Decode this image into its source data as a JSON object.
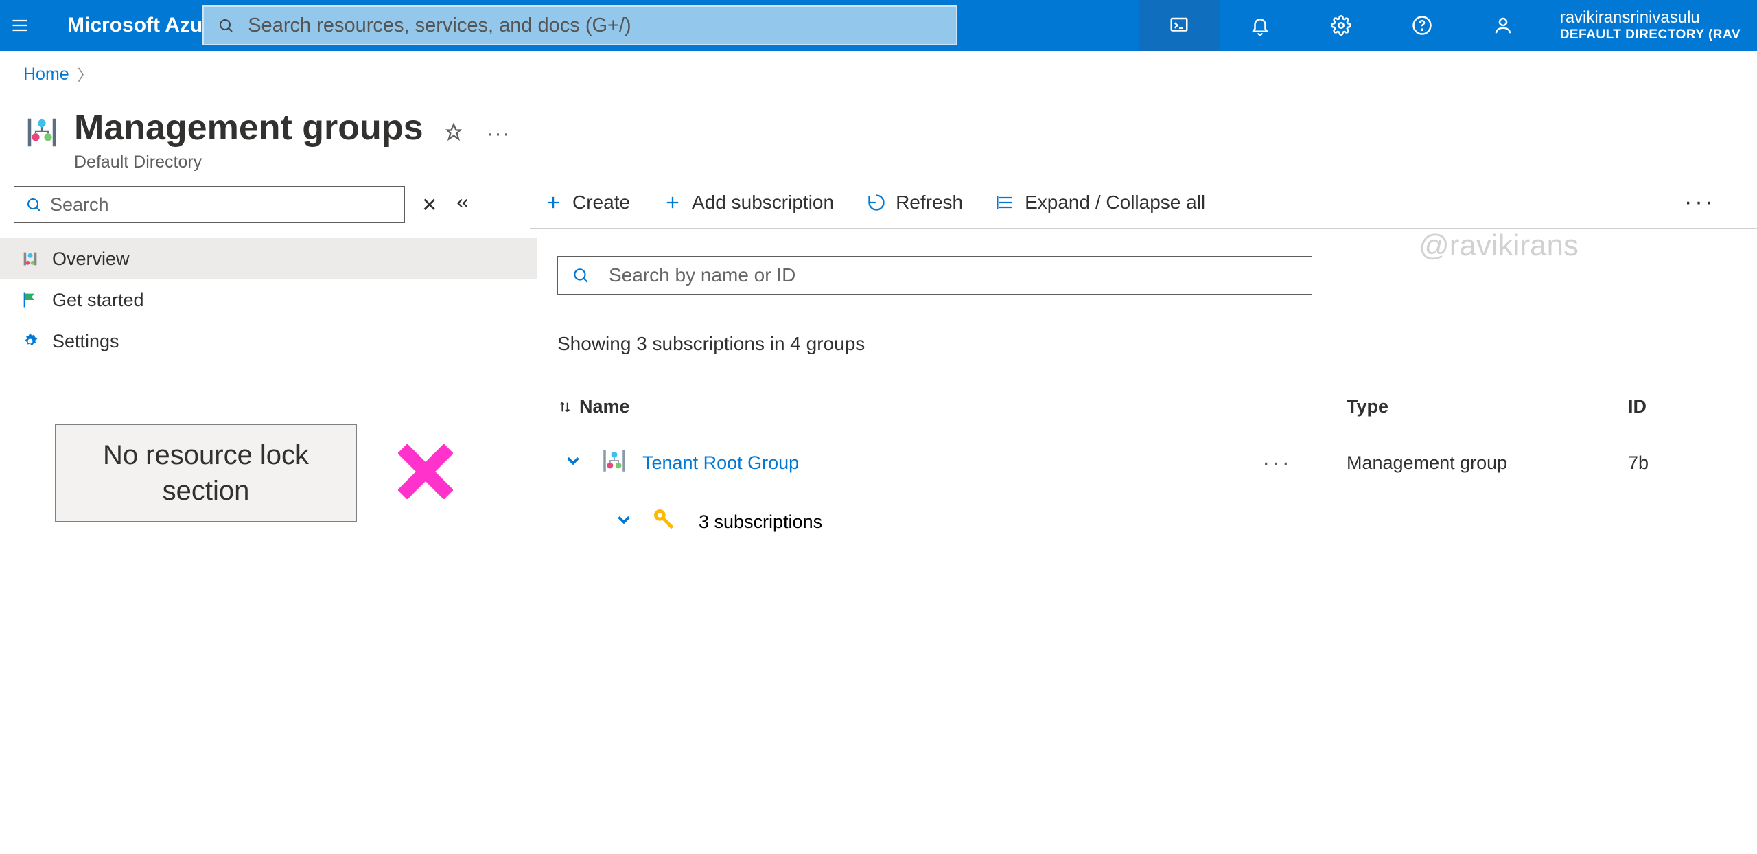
{
  "topbar": {
    "brand": "Microsoft Azu",
    "search_placeholder": "Search resources, services, and docs (G+/)",
    "account_name": "ravikiransrinivasulu",
    "account_dir": "DEFAULT DIRECTORY (RAV"
  },
  "breadcrumb": {
    "home": "Home"
  },
  "page": {
    "title": "Management groups",
    "subtitle": "Default Directory"
  },
  "sidebar": {
    "search_placeholder": "Search",
    "items": [
      {
        "label": "Overview"
      },
      {
        "label": "Get started"
      },
      {
        "label": "Settings"
      }
    ]
  },
  "annotation": {
    "text": "No resource lock section"
  },
  "toolbar": {
    "create": "Create",
    "add_sub": "Add subscription",
    "refresh": "Refresh",
    "expand": "Expand / Collapse all"
  },
  "watermark": "@ravikirans",
  "filter": {
    "placeholder": "Search by name or ID"
  },
  "summary": "Showing 3 subscriptions in 4 groups",
  "table": {
    "col_name": "Name",
    "col_type": "Type",
    "col_id": "ID",
    "rows": [
      {
        "name": "Tenant Root Group",
        "type": "Management group",
        "id": "7b"
      }
    ],
    "subs_line": "3 subscriptions"
  }
}
